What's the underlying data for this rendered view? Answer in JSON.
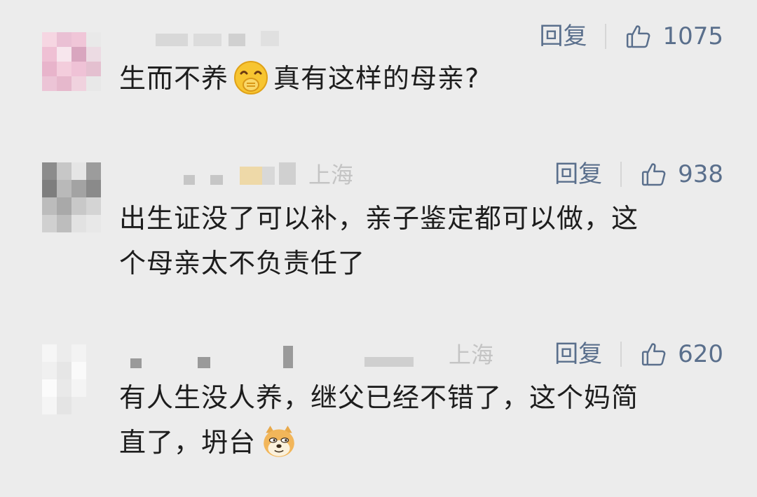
{
  "comments": [
    {
      "location": "",
      "reply_label": "回复",
      "likes": "1075",
      "text_before": "生而不养",
      "emoji": "face-with-hand-over-mouth",
      "text_after": "真有这样的母亲?"
    },
    {
      "location": "上海",
      "reply_label": "回复",
      "likes": "938",
      "line1": "出生证没了可以补，亲子鉴定都可以做，这",
      "line2": "个母亲太不负责任了"
    },
    {
      "location": "上海",
      "reply_label": "回复",
      "likes": "620",
      "line1": "有人生没人养，继父已经不错了，这个妈简",
      "line2_before": "直了，坍台",
      "emoji": "doge"
    }
  ],
  "colors": {
    "background": "#ececec",
    "action_text": "#5a6f8c",
    "body_text": "#1d1d1d",
    "location_text": "#c4c4c4"
  }
}
